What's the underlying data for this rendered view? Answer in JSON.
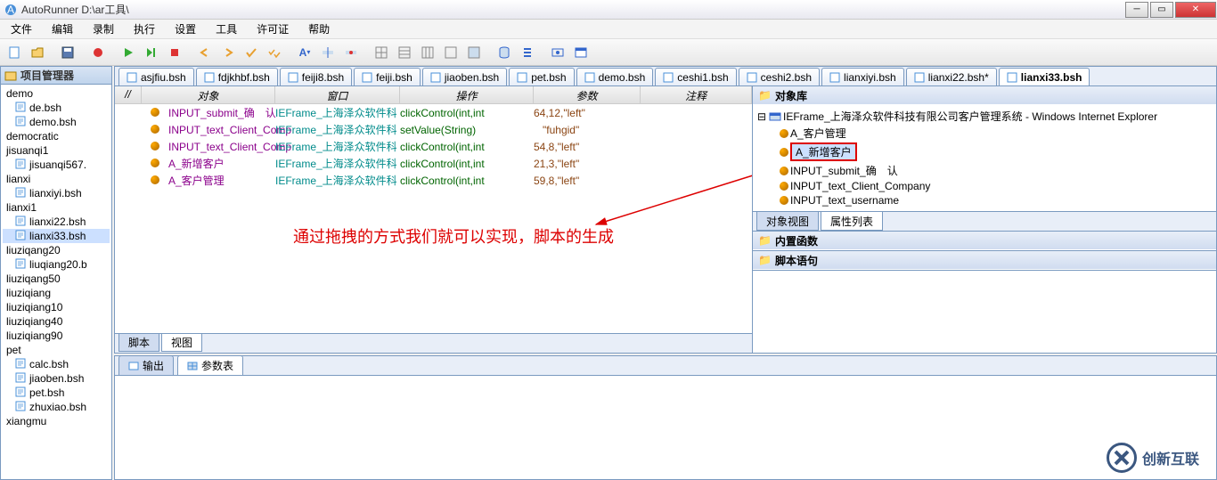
{
  "title": "AutoRunner  D:\\ar工具\\",
  "menu": [
    "文件",
    "编辑",
    "录制",
    "执行",
    "设置",
    "工具",
    "许可证",
    "帮助"
  ],
  "sidebar": {
    "header": "项目管理器",
    "items": [
      {
        "label": "demo",
        "indent": 0,
        "icon": "none"
      },
      {
        "label": "de.bsh",
        "indent": 1,
        "icon": "file"
      },
      {
        "label": "demo.bsh",
        "indent": 1,
        "icon": "file"
      },
      {
        "label": "democratic",
        "indent": 0,
        "icon": "none"
      },
      {
        "label": "jisuanqi1",
        "indent": 0,
        "icon": "none"
      },
      {
        "label": "jisuanqi567.",
        "indent": 1,
        "icon": "file"
      },
      {
        "label": "lianxi",
        "indent": 0,
        "icon": "none"
      },
      {
        "label": "lianxiyi.bsh",
        "indent": 1,
        "icon": "file"
      },
      {
        "label": "lianxi1",
        "indent": 0,
        "icon": "none"
      },
      {
        "label": "lianxi22.bsh",
        "indent": 1,
        "icon": "file"
      },
      {
        "label": "lianxi33.bsh",
        "indent": 1,
        "icon": "file",
        "selected": true
      },
      {
        "label": "liuziqang20",
        "indent": 0,
        "icon": "none"
      },
      {
        "label": "liuqiang20.b",
        "indent": 1,
        "icon": "file"
      },
      {
        "label": "liuziqang50",
        "indent": 0,
        "icon": "none"
      },
      {
        "label": "liuziqiang",
        "indent": 0,
        "icon": "none"
      },
      {
        "label": "liuziqiang10",
        "indent": 0,
        "icon": "none"
      },
      {
        "label": "liuziqiang40",
        "indent": 0,
        "icon": "none"
      },
      {
        "label": "liuziqiang90",
        "indent": 0,
        "icon": "none"
      },
      {
        "label": "pet",
        "indent": 0,
        "icon": "none"
      },
      {
        "label": "calc.bsh",
        "indent": 1,
        "icon": "file"
      },
      {
        "label": "jiaoben.bsh",
        "indent": 1,
        "icon": "file"
      },
      {
        "label": "pet.bsh",
        "indent": 1,
        "icon": "file"
      },
      {
        "label": "zhuxiao.bsh",
        "indent": 1,
        "icon": "file"
      },
      {
        "label": "xiangmu",
        "indent": 0,
        "icon": "none"
      }
    ]
  },
  "tabs": [
    {
      "label": "asjfiu.bsh"
    },
    {
      "label": "fdjkhbf.bsh"
    },
    {
      "label": "feiji8.bsh"
    },
    {
      "label": "feiji.bsh"
    },
    {
      "label": "jiaoben.bsh"
    },
    {
      "label": "pet.bsh"
    },
    {
      "label": "demo.bsh"
    },
    {
      "label": "ceshi1.bsh"
    },
    {
      "label": "ceshi2.bsh"
    },
    {
      "label": "lianxiyi.bsh"
    },
    {
      "label": "lianxi22.bsh*"
    },
    {
      "label": "lianxi33.bsh",
      "active": true
    }
  ],
  "grid_columns": {
    "idx": "//",
    "obj": "对象",
    "win": "窗口",
    "op": "操作",
    "param": "参数",
    "comment": "注释"
  },
  "grid_col_widths": {
    "idx": 30,
    "obj": 150,
    "win": 140,
    "op": 150,
    "param": 120,
    "comment": 120
  },
  "script_rows": [
    {
      "obj": "A_客户管理",
      "win": "IEFrame_上海泽众软件科",
      "op": "clickControl(int,int",
      "param": "59,8,\"left\""
    },
    {
      "obj": "A_新增客户",
      "win": "IEFrame_上海泽众软件科",
      "op": "clickControl(int,int",
      "param": "21,3,\"left\""
    },
    {
      "obj": "INPUT_text_Client_Comp",
      "win": "IEFrame_上海泽众软件科",
      "op": "clickControl(int,int",
      "param": "54,8,\"left\""
    },
    {
      "obj": "INPUT_text_Client_Comp",
      "win": "IEFrame_上海泽众软件科",
      "op": "setValue(String)",
      "param": "   \"fuhgid\""
    },
    {
      "obj": "INPUT_submit_确　认",
      "win": "IEFrame_上海泽众软件科",
      "op": "clickControl(int,int",
      "param": "64,12,\"left\""
    }
  ],
  "annotation_text": "通过拖拽的方式我们就可以实现，脚本的生成",
  "editor_bottom_tabs": {
    "script": "脚本",
    "view": "视图"
  },
  "right_panel": {
    "obj_lib": "对象库",
    "root": "IEFrame_上海泽众软件科技有限公司客户管理系统 - Windows Internet Explorer",
    "children": [
      "A_客户管理",
      "A_新增客户",
      "INPUT_submit_确　认",
      "INPUT_text_Client_Company",
      "INPUT_text_username"
    ],
    "highlighted_index": 1,
    "prop_tabs": {
      "obj_view": "对象视图",
      "attr_list": "属性列表"
    },
    "builtin": "内置函数",
    "stmt": "脚本语句"
  },
  "output": {
    "tab1": "输出",
    "tab2": "参数表"
  },
  "watermark": "创新互联"
}
